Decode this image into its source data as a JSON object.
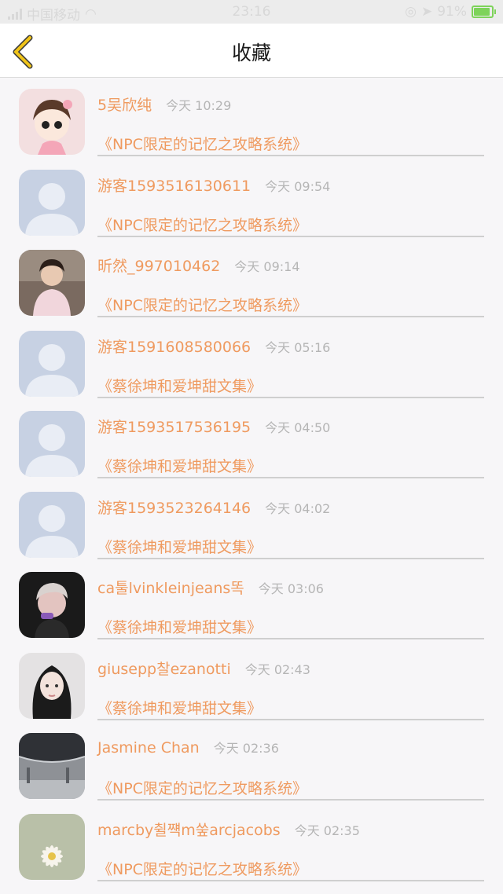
{
  "status": {
    "carrier": "中国移动",
    "time": "23:16",
    "battery": "91%"
  },
  "header": {
    "title": "收藏"
  },
  "colors": {
    "accent": "#ef9a5f",
    "back_icon": "#f0c419",
    "timestamp": "#b5b5b5"
  },
  "items": [
    {
      "name": "5吴欣纯",
      "time": "今天 10:29",
      "book": "《NPC限定的记忆之攻略系统》"
    },
    {
      "name": "游客1593516130611",
      "time": "今天 09:54",
      "book": "《NPC限定的记忆之攻略系统》"
    },
    {
      "name": "昕然_997010462",
      "time": "今天 09:14",
      "book": "《NPC限定的记忆之攻略系统》"
    },
    {
      "name": "游客1591608580066",
      "time": "今天 05:16",
      "book": "《蔡徐坤和爱坤甜文集》"
    },
    {
      "name": "游客1593517536195",
      "time": "今天 04:50",
      "book": "《蔡徐坤和爱坤甜文集》"
    },
    {
      "name": "游客1593523264146",
      "time": "今天 04:02",
      "book": "《蔡徐坤和爱坤甜文集》"
    },
    {
      "name": "ca툴lvinkleinjeans똑",
      "time": "今天 03:06",
      "book": "《蔡徐坤和爱坤甜文集》"
    },
    {
      "name": "giusepp찰ezanotti",
      "time": "今天 02:43",
      "book": "《蔡徐坤和爱坤甜文集》"
    },
    {
      "name": "Jasmine Chan",
      "time": "今天 02:36",
      "book": "《NPC限定的记忆之攻略系统》"
    },
    {
      "name": "marcby췰쨱m쑾arcjacobs",
      "time": "今天 02:35",
      "book": "《NPC限定的记忆之攻略系统》"
    }
  ]
}
